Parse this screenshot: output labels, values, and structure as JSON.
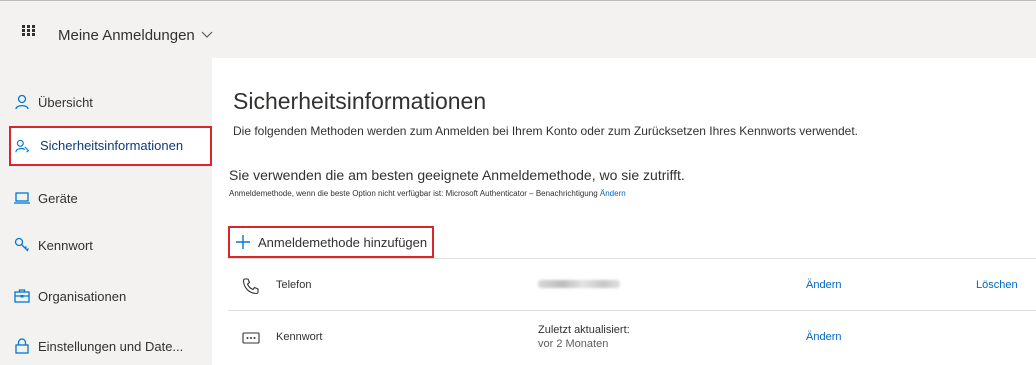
{
  "header": {
    "app_title": "Meine Anmeldungen",
    "waffle_icon": "app-launcher-icon",
    "chevron_icon": "chevron-down-icon"
  },
  "sidebar": {
    "items": [
      {
        "label": "Übersicht",
        "icon": "person-icon"
      },
      {
        "label": "Sicherheitsinformationen",
        "icon": "security-info-icon",
        "active": true
      },
      {
        "label": "Geräte",
        "icon": "laptop-icon"
      },
      {
        "label": "Kennwort",
        "icon": "key-icon"
      },
      {
        "label": "Organisationen",
        "icon": "briefcase-icon"
      },
      {
        "label": "Einstellungen und Date...",
        "icon": "lock-icon"
      }
    ]
  },
  "main": {
    "title": "Sicherheitsinformationen",
    "description": "Die folgenden Methoden werden zum Anmelden bei Ihrem Konto oder zum Zurücksetzen Ihres Kennworts verwendet.",
    "best_method_text": "Sie verwenden die am besten geeignete Anmeldemethode, wo sie zutrifft.",
    "fallback_text": "Anmeldemethode, wenn die beste Option nicht verfügbar ist: Microsoft Authenticator – Benachrichtigung",
    "fallback_link": "Ändern",
    "add_method_label": "Anmeldemethode hinzufügen"
  },
  "methods": [
    {
      "name": "Telefon",
      "icon": "phone-icon",
      "detail_redacted": true,
      "change_label": "Ändern",
      "delete_label": "Löschen"
    },
    {
      "name": "Kennwort",
      "icon": "password-dots-icon",
      "detail_line1": "Zuletzt aktualisiert:",
      "detail_line2": "vor 2 Monaten",
      "change_label": "Ändern"
    }
  ],
  "colors": {
    "accent": "#0066c0",
    "highlight_border": "#d8262c",
    "sidebar_bg": "#f3f2f1"
  }
}
